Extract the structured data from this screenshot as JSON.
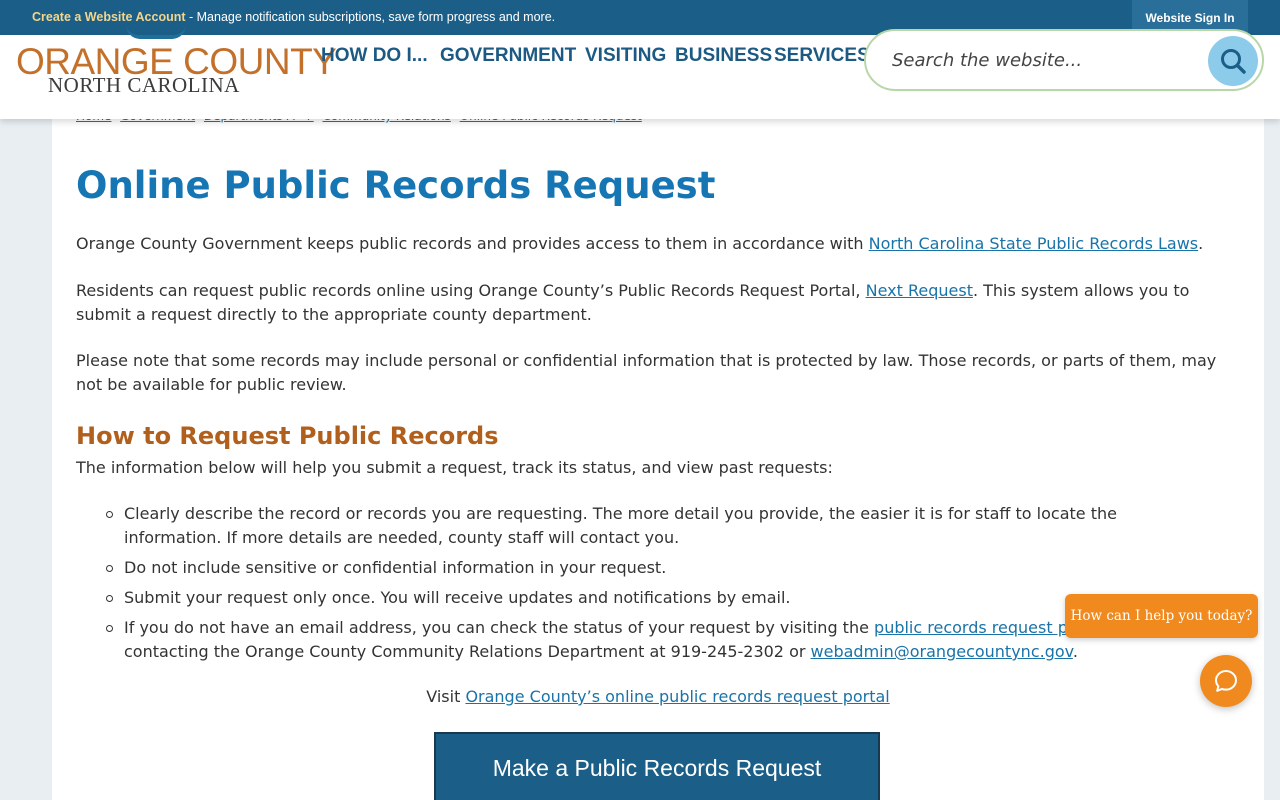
{
  "topbar": {
    "account_link": "Create a Website Account",
    "message": " - Manage notification subscriptions, save form progress and more.",
    "signin_label": "Website Sign In"
  },
  "logo": {
    "line1": "ORANGE COUNTY",
    "line2": "NORTH CAROLINA"
  },
  "nav": {
    "items": [
      "HOW DO I...",
      "GOVERNMENT",
      "VISITING",
      "BUSINESS",
      "SERVICES"
    ]
  },
  "search": {
    "placeholder": "Search the website...",
    "icon": "search-icon"
  },
  "breadcrumb": {
    "items": [
      "Home",
      "Government",
      "Departments A - F",
      "Community Relations",
      "Online Public Records Request"
    ]
  },
  "page": {
    "title": "Online Public Records Request",
    "p1_text": "Orange County Government keeps public records and provides access to them in accordance with ",
    "p1_link": "North Carolina State Public Records Laws",
    "p1_end": ".",
    "p2_text": "Residents can request public records online using Orange County’s Public Records Request Portal, ",
    "p2_link": "Next Request",
    "p2_end": ". This system allows you to submit a request directly to the appropriate county department.",
    "p3_text": "Please note that some records may include personal or confidential information that is protected by law. Those records, or parts of them, may not be available for public review.",
    "h2": "How to Request Public Records",
    "intro": "The information below will help you submit a request, track its status, and view past requests:",
    "bullets": [
      "Clearly describe the record or records you are requesting. The more detail you provide, the easier it is for staff to locate the information. If more details are needed, county staff will contact you.",
      "Do not include sensitive or confidential information in your request.",
      "Submit your request only once. You will receive updates and notifications by email."
    ],
    "bullet4_text": "If you do not have an email address, you can check the status of your request by visiting the ",
    "bullet4_link1": "public records request portal",
    "bullet4_mid": " or by contacting the Orange County Community Relations Department at 919-245-2302 or ",
    "bullet4_link2": "webadmin@orangecountync.gov",
    "bullet4_end": ".",
    "visit_text": "Visit ",
    "visit_link": "Orange County’s online public records request portal",
    "cta_label": "Make a Public Records Request"
  },
  "chat": {
    "bubble": "How can I help you today?",
    "icon": "chat-icon"
  },
  "colors": {
    "brand_blue": "#1b5f88",
    "title_blue": "#1676b4",
    "heading_orange": "#b0601c",
    "chat_orange": "#f08a1e"
  }
}
